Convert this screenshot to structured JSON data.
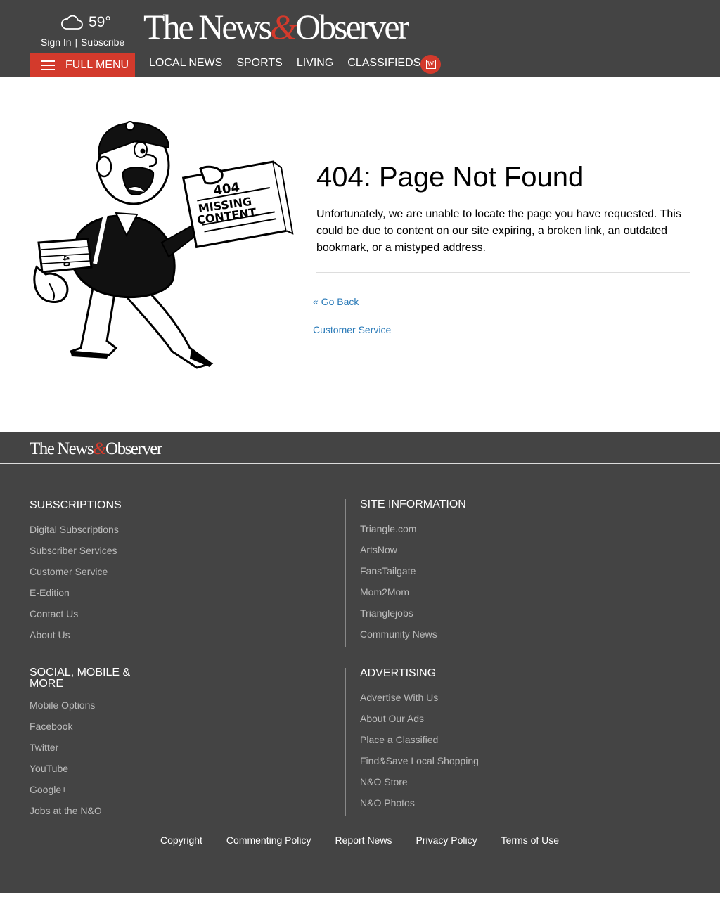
{
  "header": {
    "weather_temp": "59°",
    "sign_in": "Sign In",
    "separator": "|",
    "subscribe": "Subscribe",
    "logo_part1": "The News",
    "logo_amp": "&",
    "logo_part2": "Observer",
    "full_menu": "FULL MENU",
    "nav": [
      "LOCAL NEWS",
      "SPORTS",
      "LIVING",
      "CLASSIFIEDS"
    ],
    "badge": "W",
    "brand_color": "#d33a2c"
  },
  "illustration": {
    "paper_number": "404",
    "paper_line1": "MISSING",
    "paper_line2": "CONTENT"
  },
  "main": {
    "title": "404: Page Not Found",
    "description": "Unfortunately, we are unable to locate the page you have requested. This could be due to content on our site expiring, a broken link, an outdated bookmark, or a mistyped address.",
    "go_back": "« Go Back",
    "customer_service": "Customer Service",
    "link_color": "#2a7ab8"
  },
  "footer": {
    "logo_part1": "The News",
    "logo_amp": "&",
    "logo_part2": "Observer",
    "subscriptions": {
      "heading": "SUBSCRIPTIONS",
      "items": [
        "Digital Subscriptions",
        "Subscriber Services",
        "Customer Service",
        "E-Edition",
        "Contact Us",
        "About Us"
      ]
    },
    "site_information": {
      "heading": "SITE INFORMATION",
      "items": [
        "Triangle.com",
        "ArtsNow",
        "FansTailgate",
        "Mom2Mom",
        "Trianglejobs",
        "Community News"
      ]
    },
    "social": {
      "heading": "SOCIAL, MOBILE & MORE",
      "items": [
        "Mobile Options",
        "Facebook",
        "Twitter",
        "YouTube",
        "Google+",
        "Jobs at the N&O"
      ]
    },
    "advertising": {
      "heading": "ADVERTISING",
      "items": [
        "Advertise With Us",
        "About Our Ads",
        "Place a Classified",
        "Find&Save Local Shopping",
        "N&O Store",
        "N&O Photos"
      ]
    },
    "bottom_links": [
      "Copyright",
      "Commenting Policy",
      "Report News",
      "Privacy Policy",
      "Terms of Use"
    ]
  }
}
